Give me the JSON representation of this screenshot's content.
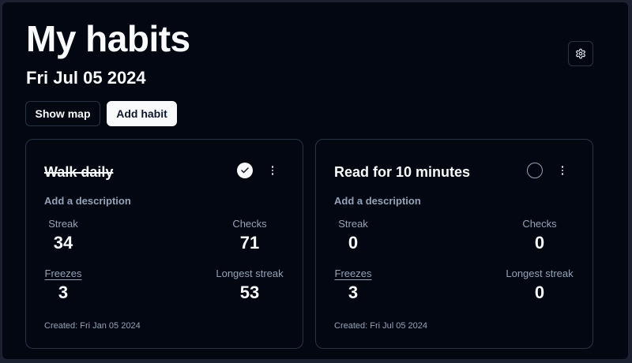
{
  "header": {
    "title": "My habits",
    "date": "Fri Jul 05 2024"
  },
  "icons": {
    "settings": "gear-icon",
    "check": "check-icon",
    "menu": "more-vertical-icon"
  },
  "toolbar": {
    "show_map_label": "Show map",
    "add_habit_label": "Add habit"
  },
  "habits": [
    {
      "name": "Walk daily",
      "completed": true,
      "description_placeholder": "Add a description",
      "stats": {
        "streak_label": "Streak",
        "streak": "34",
        "checks_label": "Checks",
        "checks": "71",
        "freezes_label": "Freezes",
        "freezes": "3",
        "longest_label": "Longest streak",
        "longest": "53"
      },
      "created": "Created: Fri Jan 05 2024"
    },
    {
      "name": "Read for 10 minutes",
      "completed": false,
      "description_placeholder": "Add a description",
      "stats": {
        "streak_label": "Streak",
        "streak": "0",
        "checks_label": "Checks",
        "checks": "0",
        "freezes_label": "Freezes",
        "freezes": "3",
        "longest_label": "Longest streak",
        "longest": "0"
      },
      "created": "Created: Fri Jul 05 2024"
    }
  ],
  "colors": {
    "background": "#030711",
    "border": "#2a3344",
    "text": "#f8fafc",
    "muted": "#94a3b8"
  }
}
